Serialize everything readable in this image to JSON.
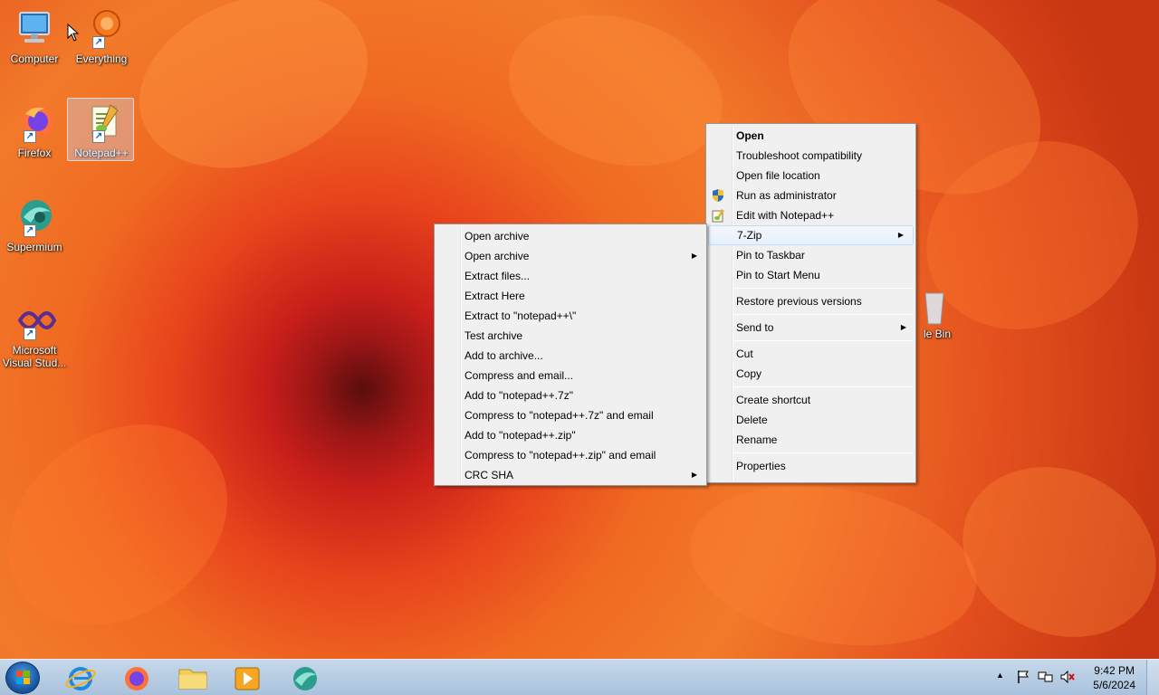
{
  "desktop": {
    "icons": [
      {
        "label": "Computer"
      },
      {
        "label": "Everything"
      },
      {
        "label": "Firefox"
      },
      {
        "label": "Notepad++"
      },
      {
        "label": "Supermium"
      },
      {
        "label": "Microsoft Visual Stud..."
      },
      {
        "label": "le Bin"
      }
    ]
  },
  "main_menu": {
    "items": [
      {
        "label": "Open"
      },
      {
        "label": "Troubleshoot compatibility"
      },
      {
        "label": "Open file location"
      },
      {
        "label": "Run as administrator"
      },
      {
        "label": "Edit with Notepad++"
      },
      {
        "label": "7-Zip"
      },
      {
        "label": "Pin to Taskbar"
      },
      {
        "label": "Pin to Start Menu"
      },
      {
        "label": "Restore previous versions"
      },
      {
        "label": "Send to"
      },
      {
        "label": "Cut"
      },
      {
        "label": "Copy"
      },
      {
        "label": "Create shortcut"
      },
      {
        "label": "Delete"
      },
      {
        "label": "Rename"
      },
      {
        "label": "Properties"
      }
    ]
  },
  "zip_menu": {
    "items": [
      {
        "label": "Open archive"
      },
      {
        "label": "Open archive"
      },
      {
        "label": "Extract files..."
      },
      {
        "label": "Extract Here"
      },
      {
        "label": "Extract to \"notepad++\\\""
      },
      {
        "label": "Test archive"
      },
      {
        "label": "Add to archive..."
      },
      {
        "label": "Compress and email..."
      },
      {
        "label": "Add to \"notepad++.7z\""
      },
      {
        "label": "Compress to \"notepad++.7z\" and email"
      },
      {
        "label": "Add to \"notepad++.zip\""
      },
      {
        "label": "Compress to \"notepad++.zip\" and email"
      },
      {
        "label": "CRC SHA"
      }
    ]
  },
  "taskbar": {
    "clock_time": "9:42 PM",
    "clock_date": "5/6/2024"
  },
  "colors": {
    "wallpaper": "#e8431c",
    "menu_bg": "#f0f0f0",
    "taskbar": "#b8cde3"
  }
}
